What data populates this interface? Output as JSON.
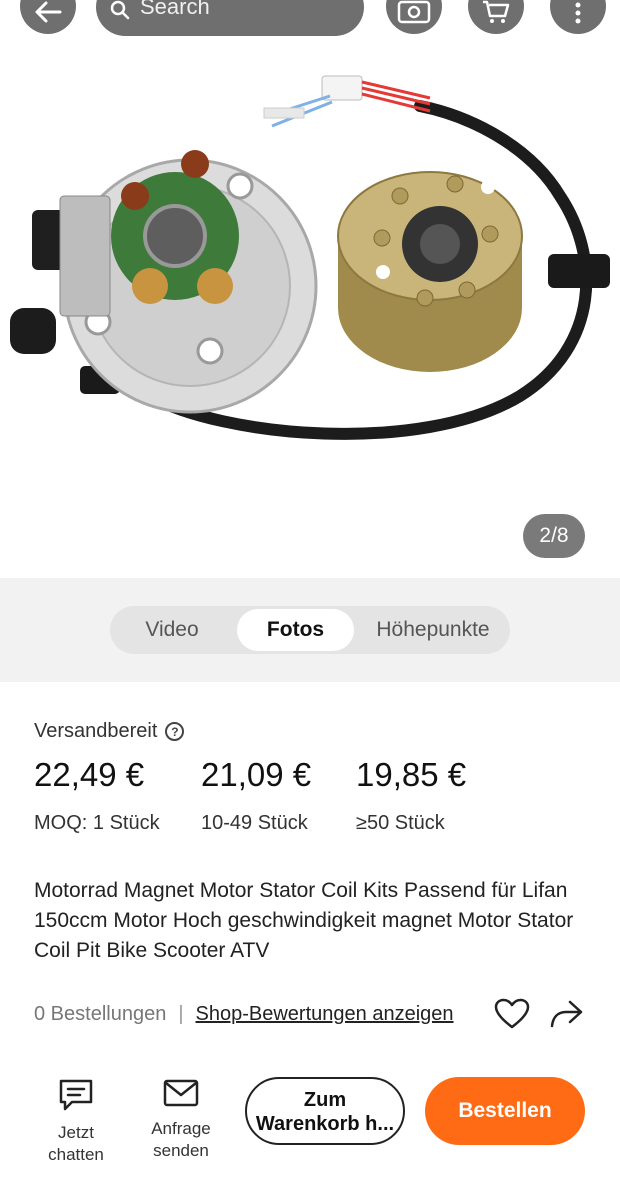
{
  "header": {
    "search_placeholder": "Search",
    "icons": [
      "back-arrow-icon",
      "search-icon",
      "camera-icon",
      "cart-icon",
      "more-icon"
    ]
  },
  "gallery": {
    "counter": "2/8",
    "product_image": "motor-stator-and-flywheel"
  },
  "media_tabs": {
    "items": [
      {
        "label": "Video",
        "selected": false
      },
      {
        "label": "Fotos",
        "selected": true
      },
      {
        "label": "Höhepunkte",
        "selected": false
      }
    ]
  },
  "product": {
    "shipping_status": "Versandbereit",
    "price_tiers": [
      {
        "price": "22,49 €",
        "quantity": "MOQ: 1 Stück"
      },
      {
        "price": "21,09 €",
        "quantity": "10-49 Stück"
      },
      {
        "price": "19,85 €",
        "quantity": "≥50 Stück"
      }
    ],
    "title": "Motorrad Magnet Motor Stator Coil Kits Passend für Lifan 150ccm Motor Hoch geschwindigkeit magnet Motor Stator Coil Pit Bike Scooter ATV",
    "orders": "0 Bestellungen",
    "separator": "|",
    "reviews_link": "Shop-Bewertungen anzeigen"
  },
  "actions": {
    "chat_line1": "Jetzt",
    "chat_line2": "chatten",
    "inquiry_line1": "Anfrage",
    "inquiry_line2": "senden",
    "cart_line1": "Zum",
    "cart_line2": "Warenkorb h...",
    "order_label": "Bestellen",
    "accent_color": "#ff6a14"
  }
}
